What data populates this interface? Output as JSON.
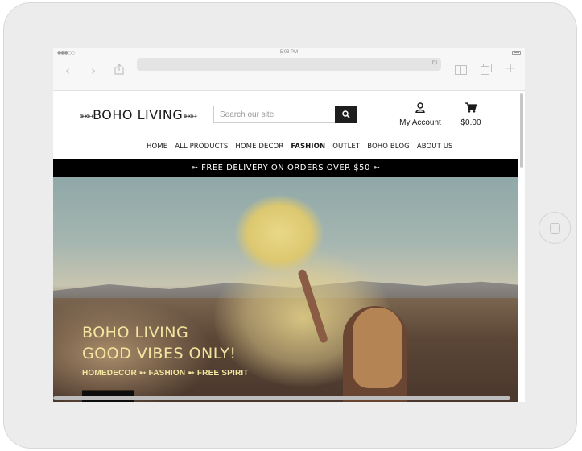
{
  "device": {
    "status_time": "5:03 PM"
  },
  "browser": {
    "signal": "●●●○○",
    "icons": [
      "back-arrow-icon",
      "forward-arrow-icon",
      "share-icon",
      "reload-icon",
      "reader-icon",
      "tabs-icon",
      "new-tab-icon"
    ]
  },
  "site": {
    "logo": "BOHO LIVING",
    "search_placeholder": "Search our site",
    "account_label": "My Account",
    "cart_total": "$0.00",
    "nav": [
      "HOME",
      "ALL PRODUCTS",
      "HOME DECOR",
      "FASHION",
      "OUTLET",
      "BOHO BLOG",
      "ABOUT US"
    ],
    "promo": "FREE DELIVERY ON ORDERS OVER $50",
    "hero": {
      "title_line1": "BOHO LIVING",
      "title_line2": "GOOD VIBES ONLY!",
      "subtitle": "HOMEDECOR ➵ FASHION ➵ FREE SPIRIT"
    }
  },
  "colors": {
    "promo_bg": "#000000",
    "hero_text": "#f3e6a0",
    "search_button": "#1e1e1e"
  }
}
